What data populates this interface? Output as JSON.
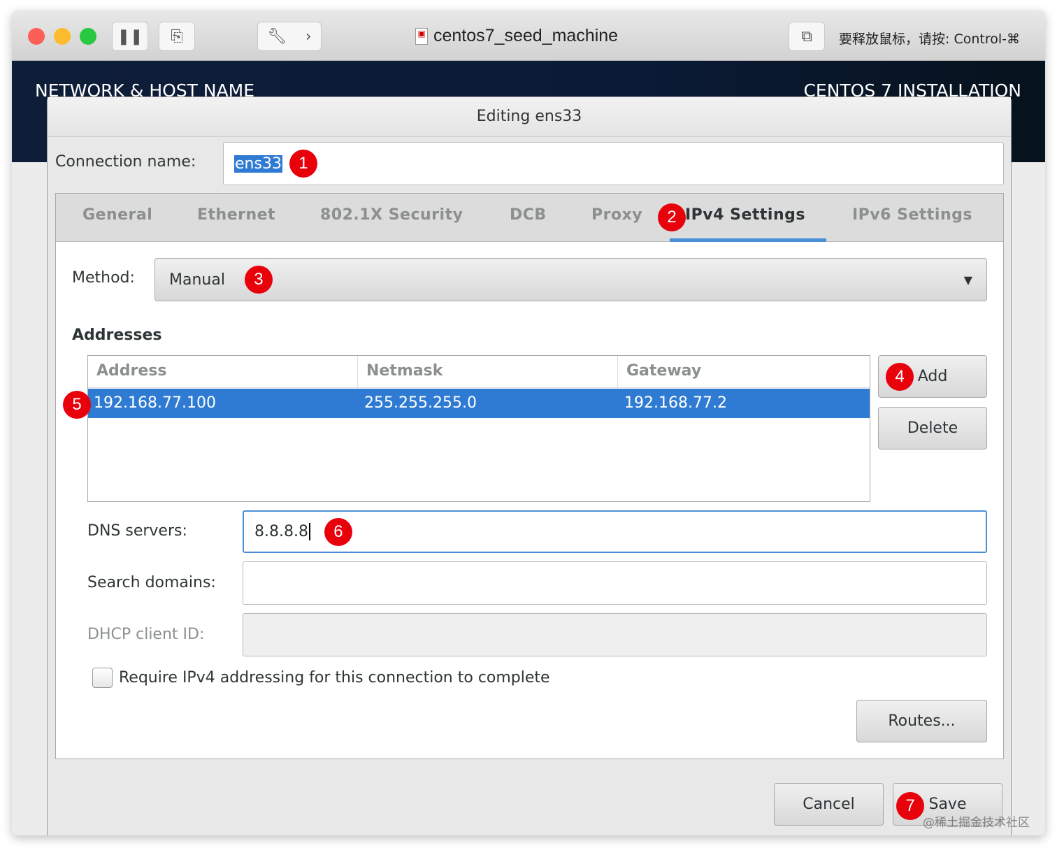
{
  "window": {
    "title": "centos7_seed_machine",
    "release_hint": "要释放鼠标，请按: Control-⌘"
  },
  "installer": {
    "left_header": "NETWORK & HOST NAME",
    "right_header": "CENTOS 7 INSTALLATION"
  },
  "dialog": {
    "title": "Editing ens33",
    "connection_name_label": "Connection name:",
    "connection_name_value": "ens33",
    "tabs": [
      {
        "label": "General"
      },
      {
        "label": "Ethernet"
      },
      {
        "label": "802.1X Security"
      },
      {
        "label": "DCB"
      },
      {
        "label": "Proxy"
      },
      {
        "label": "IPv4 Settings",
        "active": true
      },
      {
        "label": "IPv6 Settings"
      }
    ],
    "method_label": "Method:",
    "method_value": "Manual",
    "addresses_label": "Addresses",
    "columns": [
      "Address",
      "Netmask",
      "Gateway"
    ],
    "rows": [
      {
        "address": "192.168.77.100",
        "netmask": "255.255.255.0",
        "gateway": "192.168.77.2"
      }
    ],
    "add_label": "Add",
    "delete_label": "Delete",
    "dns_label": "DNS servers:",
    "dns_value": "8.8.8.8",
    "search_label": "Search domains:",
    "search_value": "",
    "dhcp_label": "DHCP client ID:",
    "dhcp_value": "",
    "require_label": "Require IPv4 addressing for this connection to complete",
    "require_checked": false,
    "routes_label": "Routes...",
    "cancel_label": "Cancel",
    "save_label": "Save"
  },
  "badges": [
    "1",
    "2",
    "3",
    "4",
    "5",
    "6",
    "7"
  ],
  "watermark": "@稀土掘金技术社区",
  "colors": {
    "accent": "#4a90d9",
    "selection": "#2f7bd4",
    "badge": "#e8000b"
  }
}
